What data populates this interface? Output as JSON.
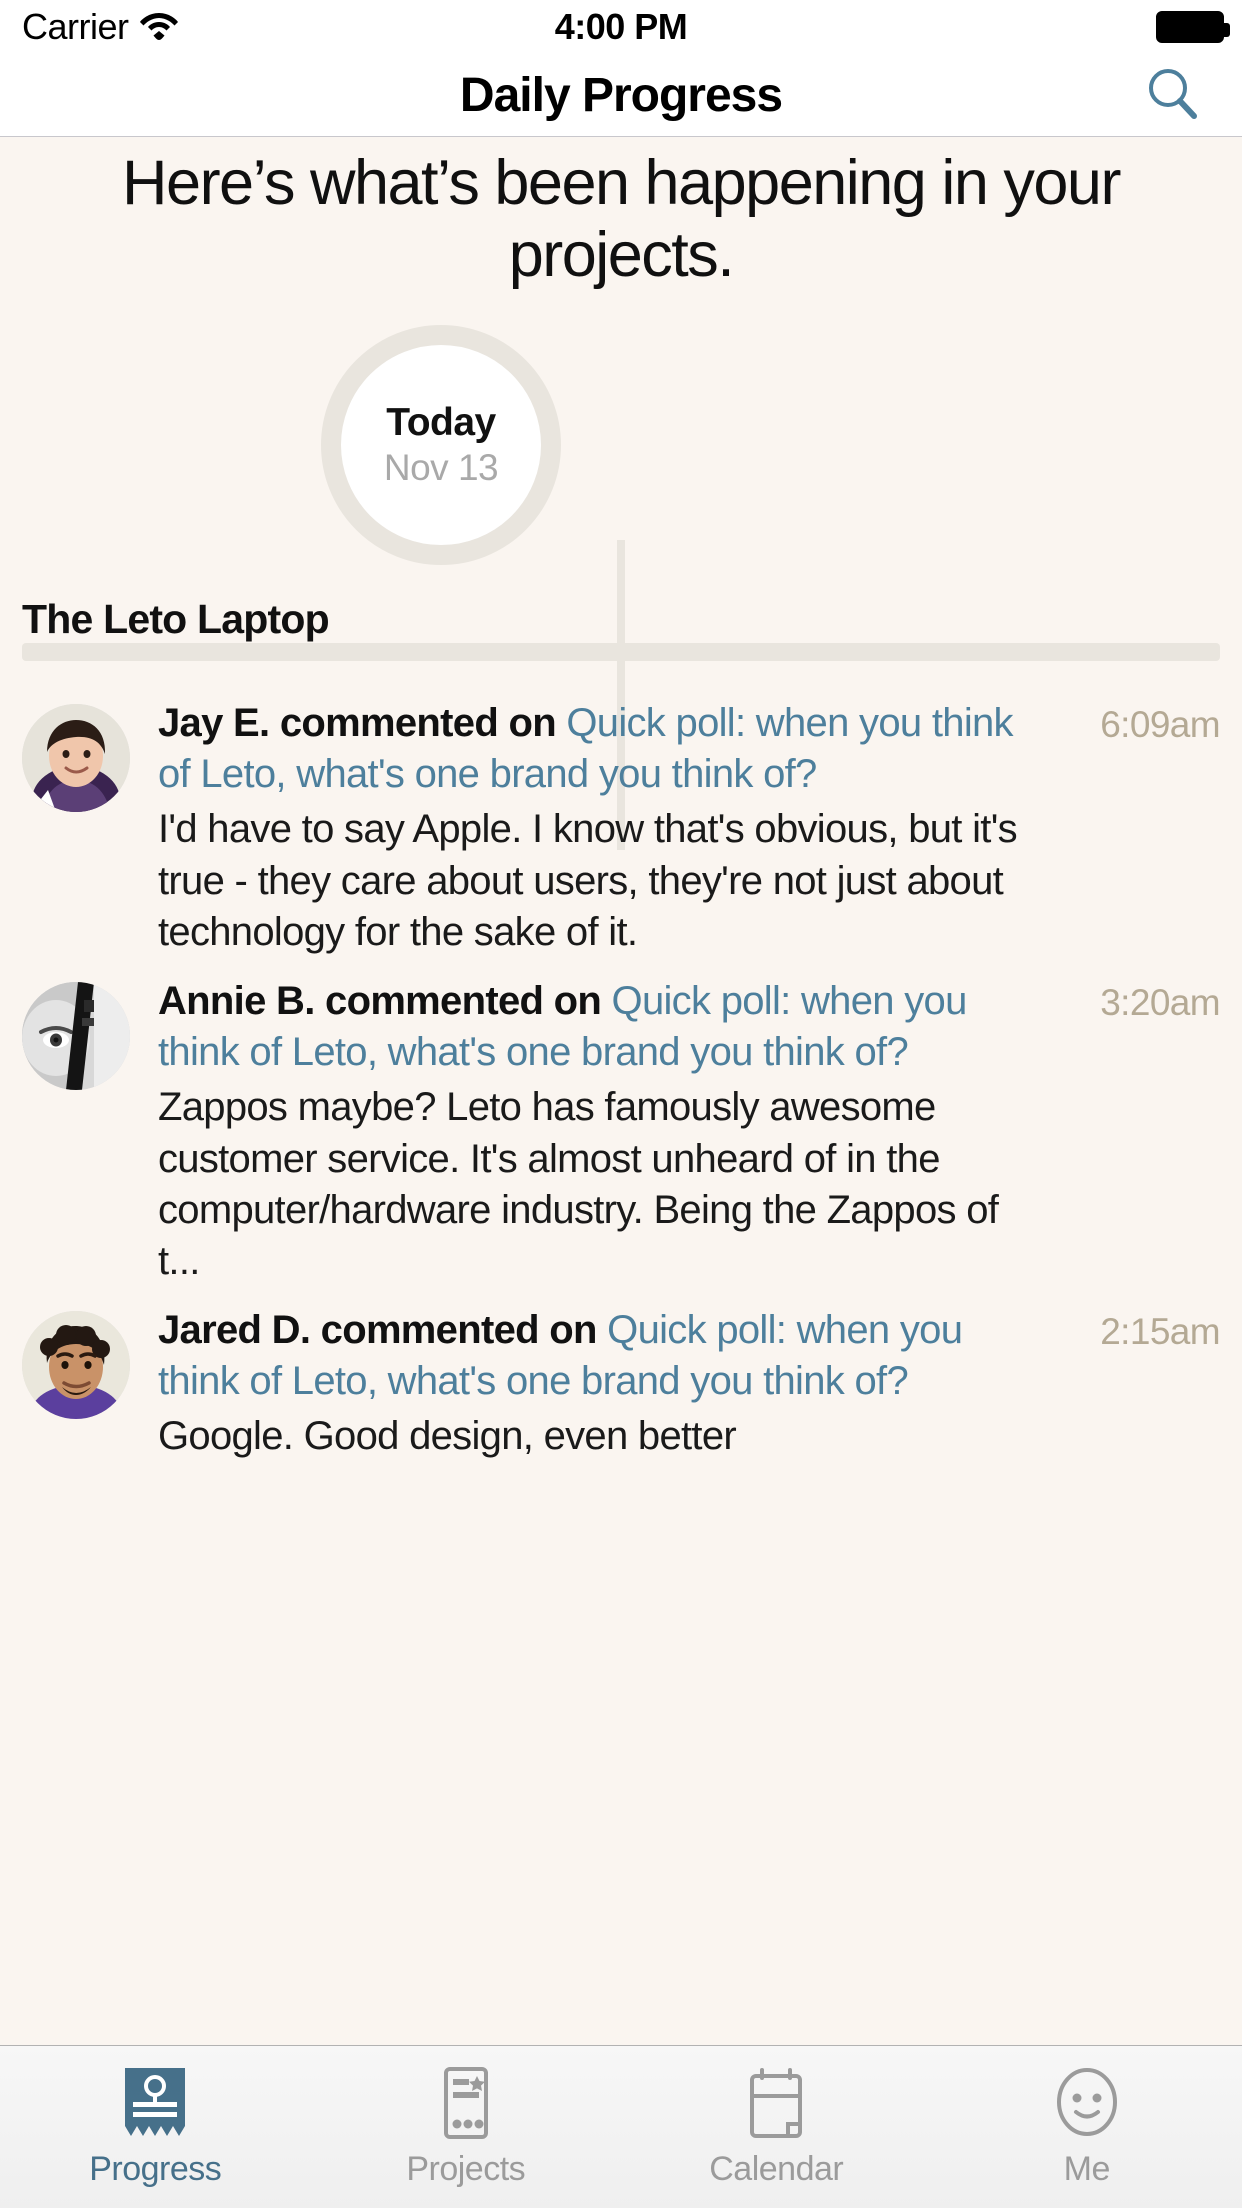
{
  "status_bar": {
    "carrier": "Carrier",
    "wifi_icon": "wifi-icon",
    "time": "4:00 PM",
    "battery_icon": "battery-full-icon"
  },
  "nav_bar": {
    "title": "Daily Progress",
    "search_icon": "search-icon"
  },
  "headline": "Here’s what’s been happening in your projects.",
  "date_marker": {
    "label": "Today",
    "date": "Nov 13"
  },
  "project": {
    "name": "The Leto Laptop"
  },
  "feed": [
    {
      "avatar": "avatar-jay",
      "actor": "Jay E. commented on ",
      "target": "Quick poll: when you think of Leto, what's one brand you think of?",
      "body": "I'd have to say Apple. I know that's obvious, but it's true - they care about users, they're not just about technology for the sake of it.",
      "time": "6:09am"
    },
    {
      "avatar": "avatar-annie",
      "actor": "Annie B. commented on ",
      "target": "Quick poll: when you think of Leto, what's one brand you think of?",
      "body": "Zappos maybe? Leto has famously awesome customer service. It's almost unheard of in the computer/hardware industry. Being the Zappos of t...",
      "time": "3:20am"
    },
    {
      "avatar": "avatar-jared",
      "actor": "Jared D. commented on ",
      "target": "Quick poll: when you think of Leto, what's one brand you think of?",
      "body": "Google. Good design, even better",
      "time": "2:15am"
    }
  ],
  "tab_bar": {
    "items": [
      {
        "label": "Progress",
        "icon": "progress-report-icon",
        "active": true
      },
      {
        "label": "Projects",
        "icon": "projects-list-icon",
        "active": false
      },
      {
        "label": "Calendar",
        "icon": "calendar-icon",
        "active": false
      },
      {
        "label": "Me",
        "icon": "smiley-face-icon",
        "active": false
      }
    ]
  },
  "colors": {
    "background": "#faf5f0",
    "link": "#4d7f9c",
    "accent": "#46708a",
    "ring": "#e9e5de",
    "timestamp": "#b4a994",
    "muted": "#9b9b9b"
  }
}
